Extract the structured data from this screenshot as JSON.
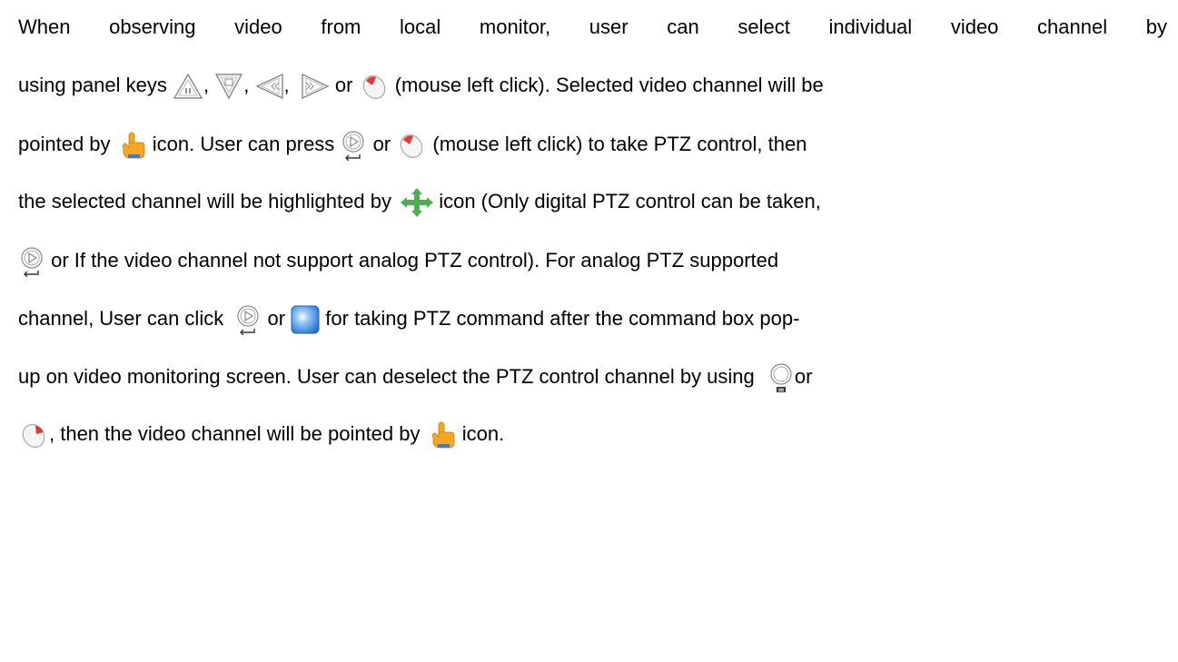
{
  "paragraph": {
    "l1": "When observing video from local monitor, user can select individual video channel by",
    "l2a": "using panel keys",
    "sep1": ",",
    "sep2": ",",
    "sep3": ",",
    "l2b": "or",
    "l2c": "(mouse left click).  Selected video channel will be",
    "l3a": "pointed by",
    "l3b": "icon. User can press",
    "l3c": "or",
    "l3d": "(mouse left click) to take PTZ control, then",
    "l4a": "the selected channel will be highlighted by",
    "l4b": "icon (Only digital PTZ control can be taken,",
    "l5a": "or If  the video channel not support analog PTZ control). For analog PTZ supported",
    "l6a": "channel, User can click",
    "l6b": "or",
    "l6c": "for taking PTZ command after the command box pop-",
    "l7a": "up on video monitoring screen. User can deselect the PTZ control channel by using",
    "l7b": "or",
    "l8a": ", then the video channel will be pointed by",
    "l8b": "icon."
  },
  "icons": [
    "up-key-icon",
    "down-key-icon",
    "left-key-icon",
    "right-key-icon",
    "mouse-left-click-icon",
    "pointing-hand-icon",
    "enter-key-icon",
    "move-arrows-icon",
    "ptz-button-icon",
    "menu-key-icon",
    "mouse-right-click-icon"
  ],
  "colors": {
    "text": "#000000",
    "hand": "#f5a623",
    "move_arrows": "#4caf50",
    "ptz_button": "#3a8ee6",
    "mouse_red": "#e53935"
  }
}
